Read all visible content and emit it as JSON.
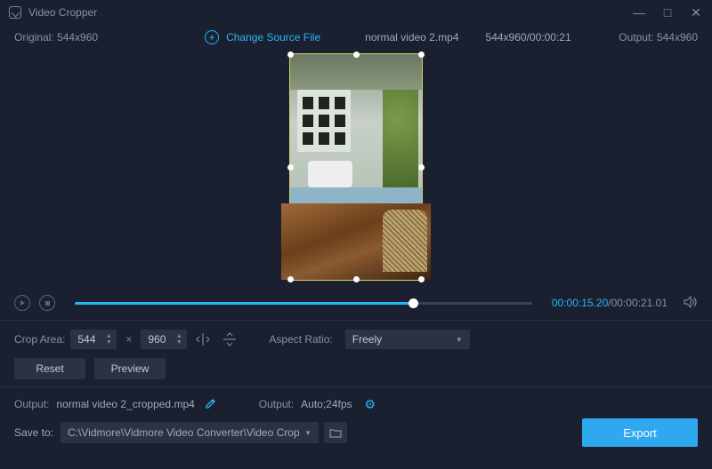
{
  "title": "Video Cropper",
  "info": {
    "original_label": "Original:",
    "original_value": "544x960",
    "change_source": "Change Source File",
    "filename": "normal video 2.mp4",
    "dims_time": "544x960/00:00:21",
    "output_label": "Output:",
    "output_value": "544x960"
  },
  "playback": {
    "current_time": "00:00:15.20",
    "duration": "00:00:21.01"
  },
  "crop": {
    "label": "Crop Area:",
    "width": "544",
    "height": "960",
    "aspect_label": "Aspect Ratio:",
    "aspect_value": "Freely"
  },
  "buttons": {
    "reset": "Reset",
    "preview": "Preview",
    "export": "Export"
  },
  "output": {
    "label1": "Output:",
    "filename": "normal video 2_cropped.mp4",
    "label2": "Output:",
    "format": "Auto;24fps"
  },
  "save": {
    "label": "Save to:",
    "path": "C:\\Vidmore\\Vidmore Video Converter\\Video Crop"
  }
}
